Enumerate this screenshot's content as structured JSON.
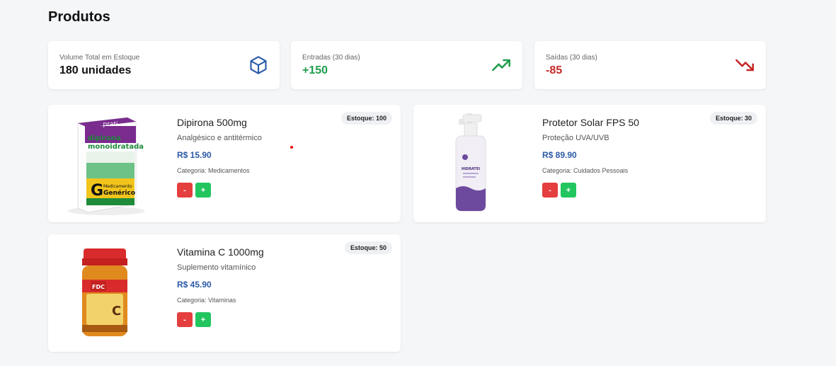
{
  "page": {
    "title": "Produtos"
  },
  "stats": [
    {
      "label": "Volume Total em Estoque",
      "value": "180 unidades",
      "color": "#111111",
      "icon": "cube-icon"
    },
    {
      "label": "Entradas (30 dias)",
      "value": "+150",
      "color": "#1f9d4c",
      "icon": "trending-up-icon"
    },
    {
      "label": "Saídas (30 dias)",
      "value": "-85",
      "color": "#c62828",
      "icon": "trending-down-icon"
    }
  ],
  "products": [
    {
      "name": "Dipirona 500mg",
      "description": "Analgésico e antitérmico",
      "price": "R$ 15.90",
      "category": "Categoria: Medicamentos",
      "stock": "Estoque: 100",
      "minus": "-",
      "plus": "+",
      "image_text": {
        "brand": "prati",
        "line1": "dipirona",
        "line2": "monoidratada",
        "badge": "G",
        "generic_line1": "Medicamento",
        "generic_line2": "Genérico"
      }
    },
    {
      "name": "Protetor Solar FPS 50",
      "description": "Proteção UVA/UVB",
      "price": "R$ 89.90",
      "category": "Categoria: Cuidados Pessoais",
      "stock": "Estoque: 30",
      "minus": "-",
      "plus": "+",
      "image_text": {
        "label": "HIDRATEI"
      }
    },
    {
      "name": "Vitamina C 1000mg",
      "description": "Suplemento vitamínico",
      "price": "R$ 45.90",
      "category": "Categoria: Vitaminas",
      "stock": "Estoque: 50",
      "minus": "-",
      "plus": "+",
      "image_text": {
        "brand": "FDC",
        "label": "C"
      }
    }
  ]
}
